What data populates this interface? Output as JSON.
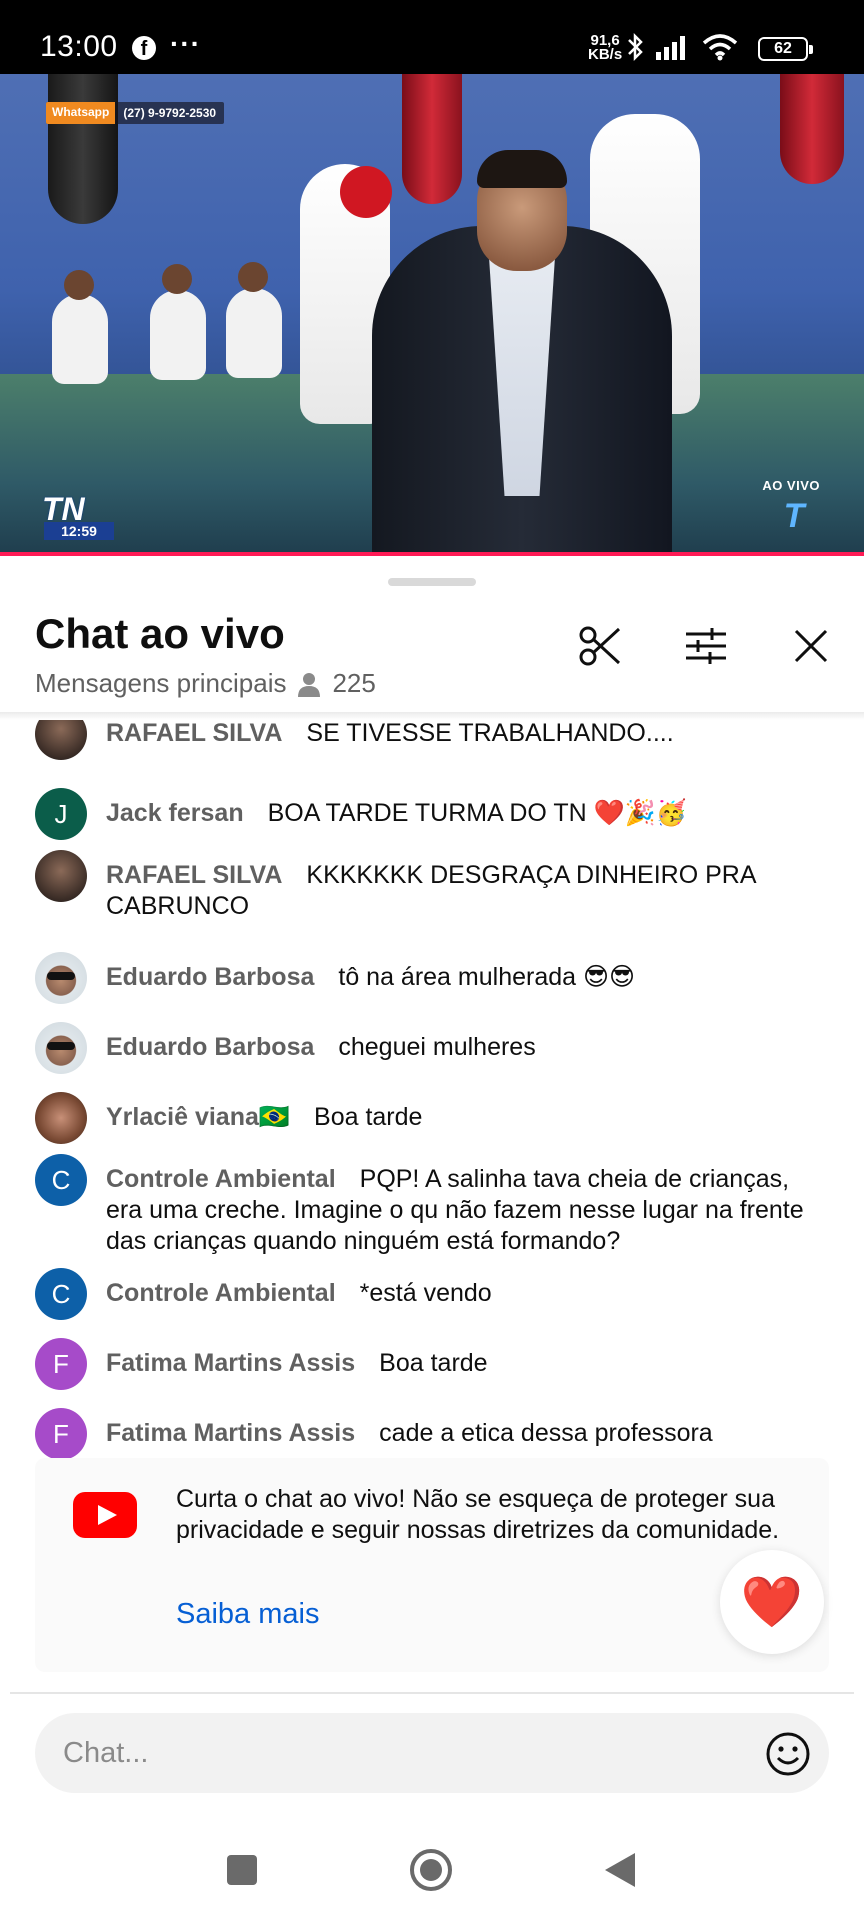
{
  "status_bar": {
    "time": "13:00",
    "more": "···",
    "speed_value": "91,6",
    "speed_unit": "KB/s",
    "battery": "62",
    "icons": [
      "facebook-icon",
      "bluetooth-icon",
      "signal-icon",
      "wifi-icon",
      "battery-icon"
    ]
  },
  "video": {
    "whatsapp_label": "Whatsapp",
    "whatsapp_number": "(27) 9-9792-2530",
    "channel_logo": "TN",
    "clock": "12:59",
    "live_label": "AO VIVO",
    "progress_color": "#ff1a55"
  },
  "chat": {
    "title": "Chat ao vivo",
    "mode": "Mensagens principais",
    "viewers": "225",
    "messages": [
      {
        "author": "RAFAEL SILVA",
        "text": "SE TIVESSE TRABALHANDO....",
        "avatar_letter": "",
        "avatar_type": "photo-rafael"
      },
      {
        "author": "Jack fersan",
        "text": "BOA TARDE TURMA DO TN ❤️🎉🥳",
        "avatar_letter": "J",
        "avatar_type": "J"
      },
      {
        "author": "RAFAEL SILVA",
        "text": "KKKKKKK DESGRAÇA DINHEIRO PRA CABRUNCO",
        "avatar_letter": "",
        "avatar_type": "photo-rafael"
      },
      {
        "author": "Eduardo Barbosa",
        "text": "tô na área mulherada 😎😎",
        "avatar_letter": "",
        "avatar_type": "photo-eduardo"
      },
      {
        "author": "Eduardo Barbosa",
        "text": "cheguei mulheres",
        "avatar_letter": "",
        "avatar_type": "photo-eduardo"
      },
      {
        "author": "Yrlaciê viana🇧🇷",
        "text": "Boa tarde",
        "avatar_letter": "",
        "avatar_type": "photo-yrl"
      },
      {
        "author": "Controle Ambiental",
        "text": "PQP! A salinha tava cheia de crianças, era uma creche. Imagine o qu não fazem nesse lugar na frente das crianças quando ninguém está formando?",
        "avatar_letter": "C",
        "avatar_type": "C"
      },
      {
        "author": "Controle Ambiental",
        "text": "*está vendo",
        "avatar_letter": "C",
        "avatar_type": "C"
      },
      {
        "author": "Fatima Martins Assis",
        "text": "Boa tarde",
        "avatar_letter": "F",
        "avatar_type": "F"
      },
      {
        "author": "Fatima Martins Assis",
        "text": "cade a etica dessa professora",
        "avatar_letter": "F",
        "avatar_type": "F"
      }
    ],
    "notice": {
      "text": "Curta o chat ao vivo! Não se esqueça de proteger sua privacidade e seguir nossas diretrizes da comunidade.",
      "link": "Saiba mais"
    },
    "reaction": "❤️",
    "input_placeholder": "Chat..."
  },
  "colors": {
    "accent_link": "#065fd4",
    "youtube_red": "#ff0000",
    "avatar_J": "#0b5d4a",
    "avatar_C": "#0d60a8",
    "avatar_F": "#a64bc9"
  }
}
